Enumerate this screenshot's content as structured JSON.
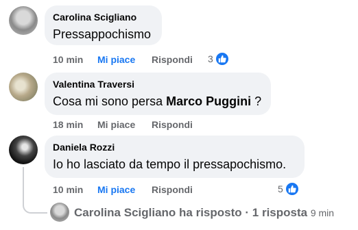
{
  "comments": [
    {
      "author": "Carolina Scigliano",
      "text": "Pressappochismo",
      "time": "10 min",
      "like_label": "Mi piace",
      "reply_label": "Rispondi",
      "reaction_count": "3"
    },
    {
      "author": "Valentina Traversi",
      "text_before": "Cosa mi sono persa ",
      "mention": "Marco Puggini",
      "text_after": " ?",
      "time": "18 min",
      "like_label": "Mi piace",
      "reply_label": "Rispondi"
    },
    {
      "author": "Daniela Rozzi",
      "text": "Io ho lasciato da tempo il pressapochismo.",
      "time": "10 min",
      "like_label": "Mi piace",
      "reply_label": "Rispondi",
      "reaction_count": "5"
    }
  ],
  "reply_summary": {
    "who": "Carolina Scigliano ha risposto",
    "separator": " · ",
    "count": "1 risposta",
    "time": "9 min"
  },
  "colors": {
    "accent": "#1877f2",
    "bubble": "#f0f2f5",
    "muted": "#65676b"
  },
  "icons": [
    "avatar",
    "like-reaction-icon"
  ]
}
